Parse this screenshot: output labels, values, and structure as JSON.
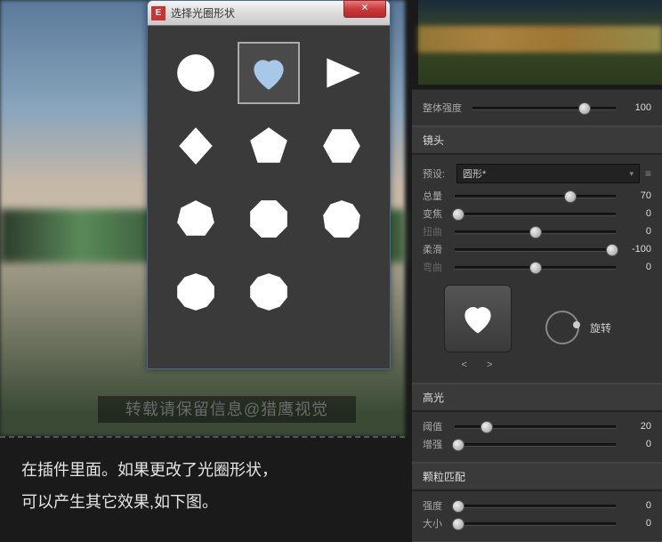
{
  "dialog": {
    "icon_letter": "E",
    "title": "选择光圈形状",
    "close": "✕",
    "selected_index": 1,
    "shapes": [
      "circle",
      "heart",
      "triangle",
      "diamond",
      "pentagon",
      "hexagon",
      "heptagon",
      "octagon",
      "nonagon",
      "decagon1",
      "decagon2"
    ]
  },
  "panel": {
    "master": {
      "label": "整体强度",
      "value": 100,
      "pos": 78
    },
    "lens": {
      "section": "镜头",
      "preset_label": "预设:",
      "preset_value": "圆形*",
      "sliders": [
        {
          "label": "总量",
          "value": 70,
          "pos": 72,
          "dim": false
        },
        {
          "label": "变焦",
          "value": 0,
          "pos": 2,
          "dim": false
        },
        {
          "label": "扭曲",
          "value": 0,
          "pos": 50,
          "dim": true
        },
        {
          "label": "柔滑",
          "value": -100,
          "pos": 98,
          "dim": false
        },
        {
          "label": "弯曲",
          "value": 0,
          "pos": 50,
          "dim": true
        }
      ],
      "rotation_label": "旋转",
      "nav_prev": "<",
      "nav_next": ">"
    },
    "highlight": {
      "section": "高光",
      "sliders": [
        {
          "label": "阈值",
          "value": 20,
          "pos": 20,
          "dim": false
        },
        {
          "label": "增强",
          "value": 0,
          "pos": 2,
          "dim": false
        }
      ]
    },
    "grain": {
      "section": "颗粒匹配",
      "sliders": [
        {
          "label": "强度",
          "value": 0,
          "pos": 2,
          "dim": false
        },
        {
          "label": "大小",
          "value": 0,
          "pos": 2,
          "dim": false
        }
      ]
    }
  },
  "watermark": "转载请保留信息@猎鹰视觉",
  "caption_line1": "在插件里面。如果更改了光圈形状，",
  "caption_line2": "可以产生其它效果,如下图。"
}
